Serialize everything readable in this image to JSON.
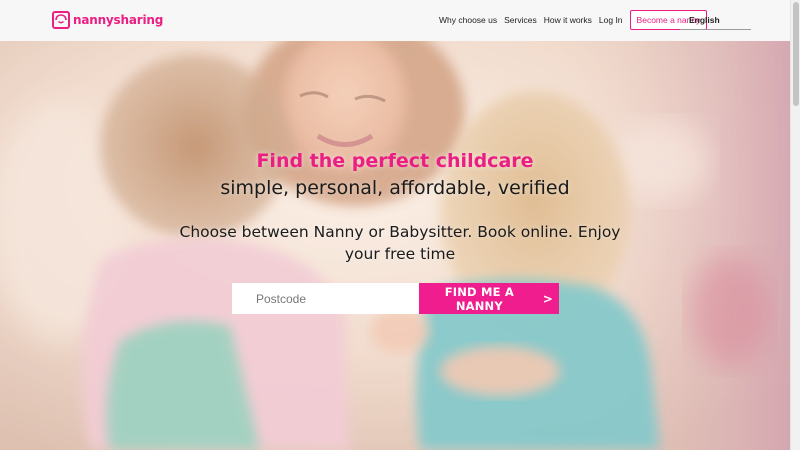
{
  "header": {
    "logo_text": "nannysharing",
    "nav": [
      {
        "label": "Why choose us"
      },
      {
        "label": "Services"
      },
      {
        "label": "How it works"
      },
      {
        "label": "Log In"
      }
    ],
    "cta_label": "Become a nanny",
    "language": "English"
  },
  "hero": {
    "headline": "Find the perfect childcare",
    "subheadline": "simple, personal, affordable, verified",
    "tagline": "Choose between Nanny or Babysitter. Book online. Enjoy your free time",
    "search": {
      "placeholder": "Postcode",
      "value": "",
      "button_label": "FIND ME A NANNY",
      "button_chevron": ">"
    }
  },
  "colors": {
    "brand": "#ea1e83",
    "button": "#ef1d8e",
    "header_bg": "#f7f7f7"
  },
  "icons": {
    "logo": "nanny-face-logo-icon",
    "chevron": "chevron-right-icon"
  }
}
